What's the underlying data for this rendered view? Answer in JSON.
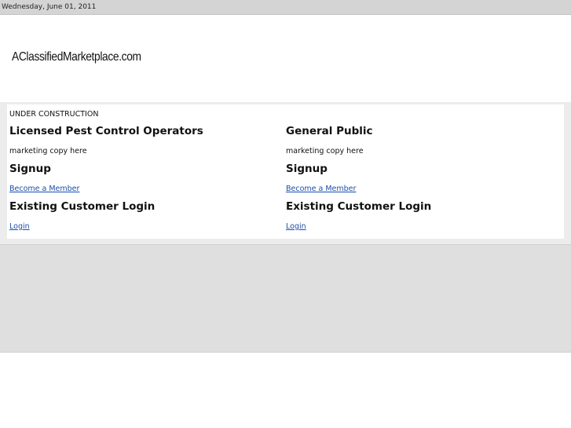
{
  "header": {
    "date": "Wednesday, June 01, 2011",
    "logo_text": "AClassifiedMarketplace.com"
  },
  "main": {
    "notice": "UNDER CONSTRUCTION",
    "columns": [
      {
        "title": "Licensed Pest Control Operators",
        "copy": "marketing copy here",
        "signup_heading": "Signup",
        "signup_link": "Become a Member",
        "login_heading": "Existing Customer Login",
        "login_link": "Login"
      },
      {
        "title": "General Public",
        "copy": "marketing copy here",
        "signup_heading": "Signup",
        "signup_link": "Become a Member",
        "login_heading": "Existing Customer Login",
        "login_link": "Login"
      }
    ]
  },
  "colors": {
    "top_bar": "#d4d4d4",
    "content_band": "#ececec",
    "footer_band": "#dfdfdf",
    "link": "#1a4fa8"
  }
}
